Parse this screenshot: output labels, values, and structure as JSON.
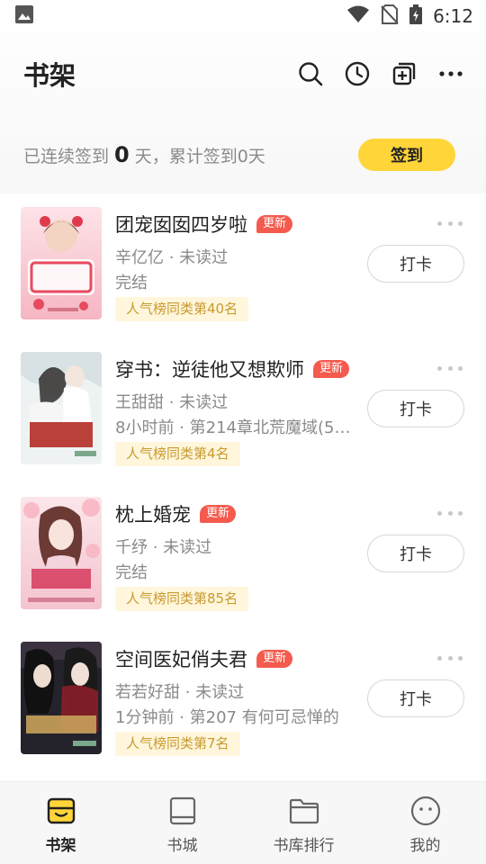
{
  "status_bar": {
    "time": "6:12",
    "left_icon": "image-icon",
    "right_icons": [
      "wifi-icon",
      "no-sim-icon",
      "battery-charging-icon"
    ]
  },
  "header": {
    "title": "书架",
    "actions": [
      "search-icon",
      "history-icon",
      "add-icon",
      "more-icon"
    ]
  },
  "signin": {
    "prefix": "已连续签到",
    "days": "0",
    "suffix": "天，累计签到0天",
    "button": "签到"
  },
  "books": [
    {
      "title": "团宠囡囡四岁啦",
      "badge": "更新",
      "author": "辛亿亿 · 未读过",
      "progress": "完结",
      "rank": "人气榜同类第40名",
      "checkin": "打卡",
      "cover_colors": [
        "#f9c6cf",
        "#e84a5f"
      ]
    },
    {
      "title": "穿书：逆徒他又想欺师",
      "badge": "更新",
      "author": "王甜甜 · 未读过",
      "progress": "8小时前 · 第214章北荒魔域(5)他...",
      "rank": "人气榜同类第4名",
      "checkin": "打卡",
      "cover_colors": [
        "#e9eef0",
        "#b4322a"
      ]
    },
    {
      "title": "枕上婚宠",
      "badge": "更新",
      "author": "千纾 · 未读过",
      "progress": "完结",
      "rank": "人气榜同类第85名",
      "checkin": "打卡",
      "cover_colors": [
        "#f8d5dc",
        "#d63a5c"
      ]
    },
    {
      "title": "空间医妃俏夫君",
      "badge": "更新",
      "author": "若若好甜 · 未读过",
      "progress": "1分钟前 · 第207 有何可忌惮的",
      "rank": "人气榜同类第7名",
      "checkin": "打卡",
      "cover_colors": [
        "#2a2a33",
        "#c9a15a"
      ]
    }
  ],
  "nav": [
    {
      "label": "书架",
      "icon": "bookshelf-icon",
      "active": true
    },
    {
      "label": "书城",
      "icon": "book-icon",
      "active": false
    },
    {
      "label": "书库排行",
      "icon": "folder-icon",
      "active": false
    },
    {
      "label": "我的",
      "icon": "profile-face-icon",
      "active": false
    }
  ],
  "colors": {
    "accent_yellow": "#ffd53a",
    "badge_red": "#f55a4e",
    "rank_bg": "#fff6dc",
    "rank_text": "#c89a2e"
  }
}
